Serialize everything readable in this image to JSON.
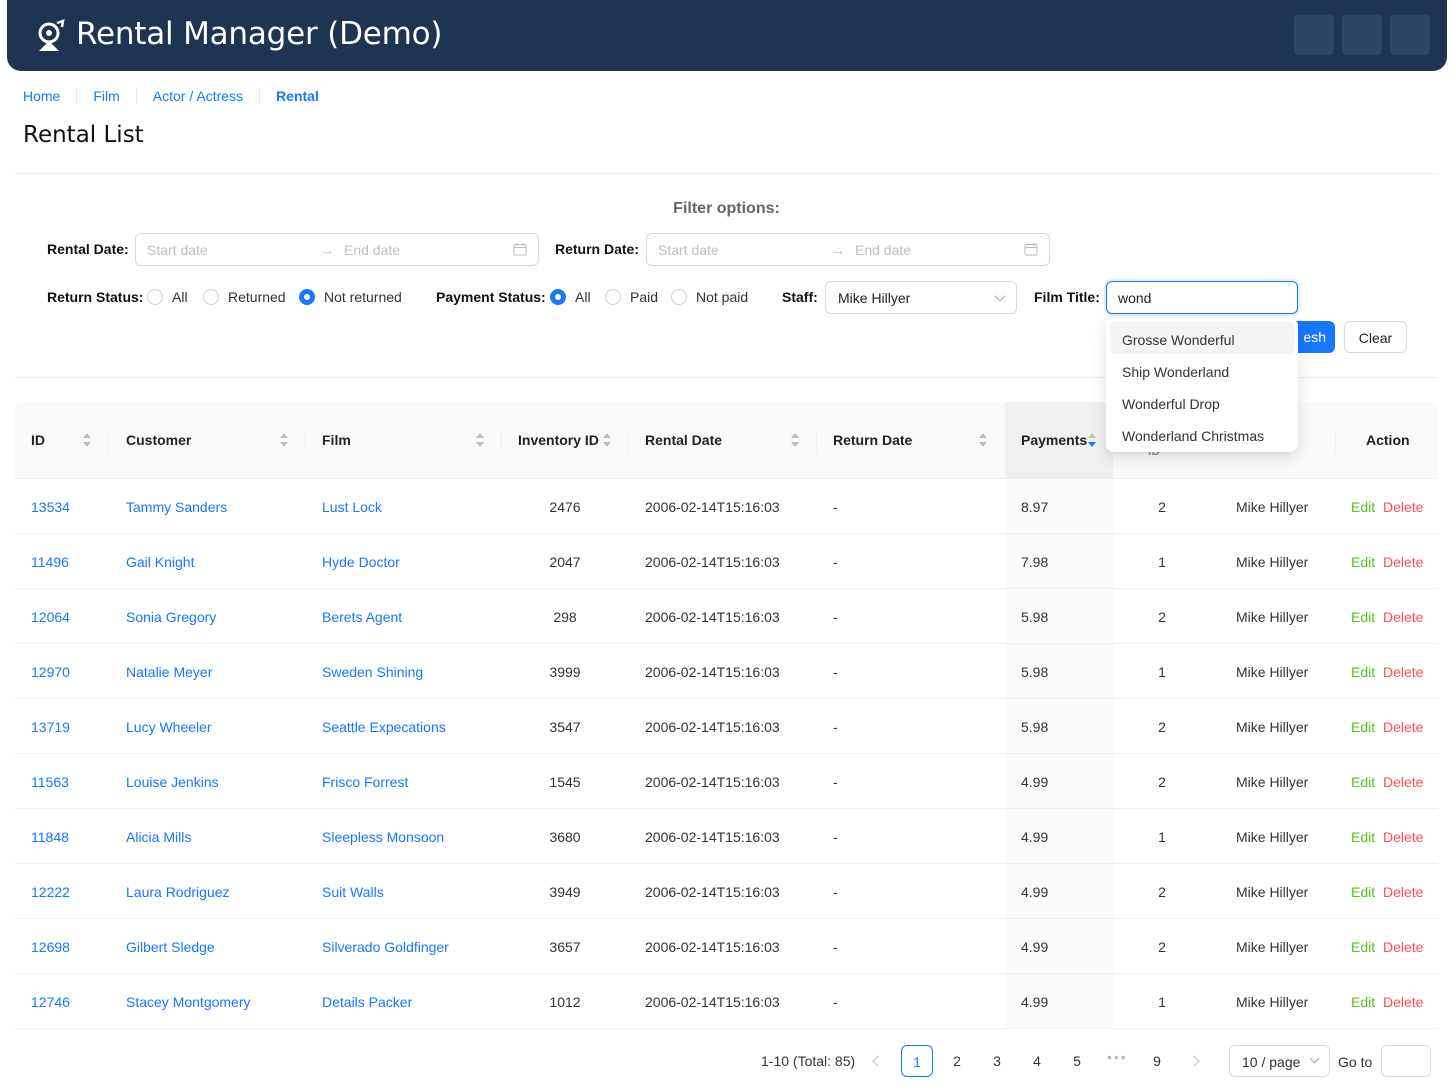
{
  "app": {
    "title": "Rental Manager (Demo)"
  },
  "breadcrumb": [
    "Home",
    "Film",
    "Actor / Actress",
    "Rental"
  ],
  "page_title": "Rental List",
  "filters": {
    "heading": "Filter options:",
    "rental_date": {
      "label": "Rental Date:",
      "start_placeholder": "Start date",
      "end_placeholder": "End date"
    },
    "return_date": {
      "label": "Return Date:",
      "start_placeholder": "Start date",
      "end_placeholder": "End date"
    },
    "return_status": {
      "label": "Return Status:",
      "options": [
        "All",
        "Returned",
        "Not returned"
      ],
      "selected": "Not returned"
    },
    "payment_status": {
      "label": "Payment Status:",
      "options": [
        "All",
        "Paid",
        "Not paid"
      ],
      "selected": "All"
    },
    "staff": {
      "label": "Staff:",
      "value": "Mike Hillyer"
    },
    "film_title": {
      "label": "Film Title:",
      "value": "wond",
      "suggestions": [
        "Grosse Wonderful",
        "Ship Wonderland",
        "Wonderful Drop",
        "Wonderland Christmas"
      ]
    },
    "refresh_label": "esh",
    "clear_label": "Clear"
  },
  "table": {
    "columns": [
      "ID",
      "Customer",
      "Film",
      "Inventory ID",
      "Rental Date",
      "Return Date",
      "Payments",
      "ID",
      "Action"
    ],
    "sorted_column": "Payments",
    "sorted_direction": "descending",
    "rows": [
      {
        "id": "13534",
        "customer": "Tammy Sanders",
        "film": "Lust Lock",
        "inventory_id": "2476",
        "rental_date": "2006-02-14T15:16:03",
        "return_date": "-",
        "payments": "8.97",
        "store_id": "2",
        "staff": "Mike Hillyer"
      },
      {
        "id": "11496",
        "customer": "Gail Knight",
        "film": "Hyde Doctor",
        "inventory_id": "2047",
        "rental_date": "2006-02-14T15:16:03",
        "return_date": "-",
        "payments": "7.98",
        "store_id": "1",
        "staff": "Mike Hillyer"
      },
      {
        "id": "12064",
        "customer": "Sonia Gregory",
        "film": "Berets Agent",
        "inventory_id": "298",
        "rental_date": "2006-02-14T15:16:03",
        "return_date": "-",
        "payments": "5.98",
        "store_id": "2",
        "staff": "Mike Hillyer"
      },
      {
        "id": "12970",
        "customer": "Natalie Meyer",
        "film": "Sweden Shining",
        "inventory_id": "3999",
        "rental_date": "2006-02-14T15:16:03",
        "return_date": "-",
        "payments": "5.98",
        "store_id": "1",
        "staff": "Mike Hillyer"
      },
      {
        "id": "13719",
        "customer": "Lucy Wheeler",
        "film": "Seattle Expecations",
        "inventory_id": "3547",
        "rental_date": "2006-02-14T15:16:03",
        "return_date": "-",
        "payments": "5.98",
        "store_id": "2",
        "staff": "Mike Hillyer"
      },
      {
        "id": "11563",
        "customer": "Louise Jenkins",
        "film": "Frisco Forrest",
        "inventory_id": "1545",
        "rental_date": "2006-02-14T15:16:03",
        "return_date": "-",
        "payments": "4.99",
        "store_id": "2",
        "staff": "Mike Hillyer"
      },
      {
        "id": "11848",
        "customer": "Alicia Mills",
        "film": "Sleepless Monsoon",
        "inventory_id": "3680",
        "rental_date": "2006-02-14T15:16:03",
        "return_date": "-",
        "payments": "4.99",
        "store_id": "1",
        "staff": "Mike Hillyer"
      },
      {
        "id": "12222",
        "customer": "Laura Rodriguez",
        "film": "Suit Walls",
        "inventory_id": "3949",
        "rental_date": "2006-02-14T15:16:03",
        "return_date": "-",
        "payments": "4.99",
        "store_id": "2",
        "staff": "Mike Hillyer"
      },
      {
        "id": "12698",
        "customer": "Gilbert Sledge",
        "film": "Silverado Goldfinger",
        "inventory_id": "3657",
        "rental_date": "2006-02-14T15:16:03",
        "return_date": "-",
        "payments": "4.99",
        "store_id": "2",
        "staff": "Mike Hillyer"
      },
      {
        "id": "12746",
        "customer": "Stacey Montgomery",
        "film": "Details Packer",
        "inventory_id": "1012",
        "rental_date": "2006-02-14T15:16:03",
        "return_date": "-",
        "payments": "4.99",
        "store_id": "1",
        "staff": "Mike Hillyer"
      }
    ],
    "action_labels": {
      "edit": "Edit",
      "delete": "Delete"
    }
  },
  "pagination": {
    "summary": "1-10 (Total: 85)",
    "pages": [
      "1",
      "2",
      "3",
      "4",
      "5",
      "9"
    ],
    "current": "1",
    "ellipsis": "•••",
    "page_size": "10 / page",
    "goto_label": "Go to"
  },
  "colors": {
    "header_bg": "#1f3452",
    "accent": "#1677ff",
    "edit": "#52c41a",
    "delete": "#ff4d4f"
  }
}
